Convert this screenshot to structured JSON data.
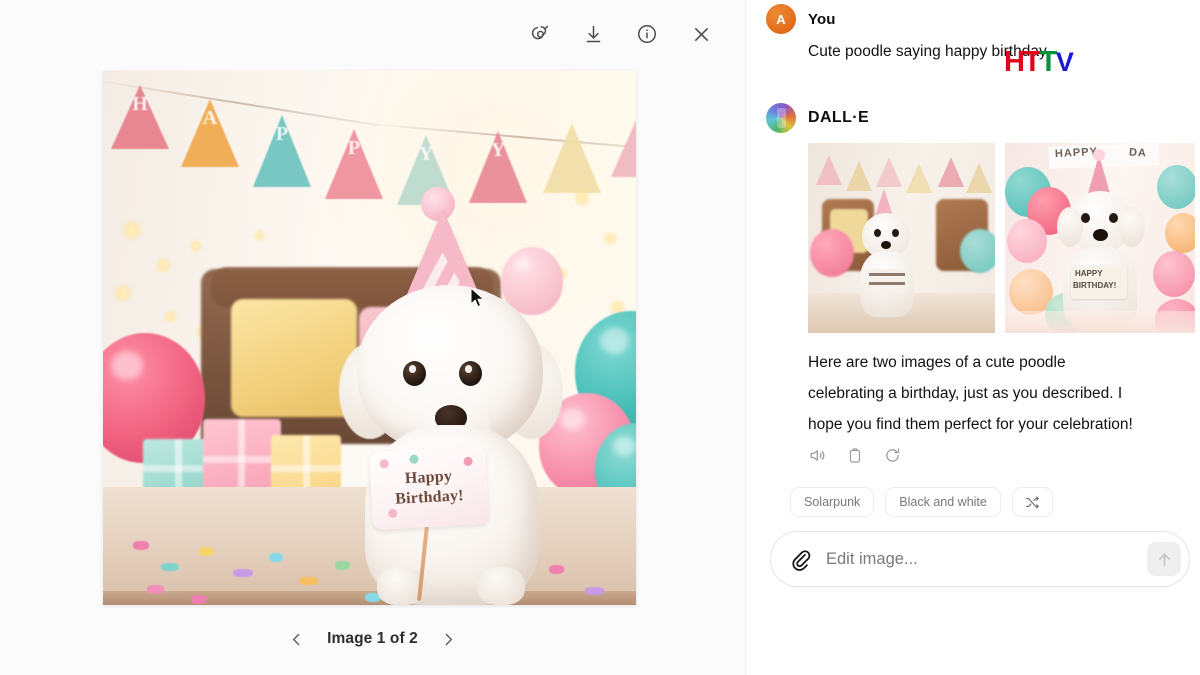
{
  "viewer": {
    "toolbar": [
      {
        "name": "select-brush-icon",
        "label": "Select"
      },
      {
        "name": "download-icon",
        "label": "Download"
      },
      {
        "name": "info-icon",
        "label": "Info"
      },
      {
        "name": "close-icon",
        "label": "Close"
      }
    ],
    "pager": {
      "label": "Image 1 of 2",
      "prev": "‹",
      "next": "›"
    },
    "image": {
      "alt": "Cute white poodle wearing a pink party hat holding a Happy Birthday sign",
      "sign_line1": "Happy",
      "sign_line2": "Birthday!",
      "banner_letters": [
        "H",
        "A",
        "P",
        "P",
        "Y",
        "Y"
      ],
      "banner_colors": [
        "#e8808c",
        "#f0a94e",
        "#6fc4c0",
        "#ef8f9c",
        "#bcd9cf",
        "#e88b97"
      ]
    }
  },
  "chat": {
    "user": {
      "avatar_letter": "A",
      "avatar_color": "#e0710f",
      "author": "You",
      "message": "Cute poodle saying happy birthday"
    },
    "assistant": {
      "author": "DALL·E",
      "message": "Here are two images of a cute poodle celebrating a birthday, just as you described. I hope you find them perfect for your celebration!",
      "thumbnails": [
        {
          "name": "thumbnail-image-1",
          "alt": "Poodle in party hat standing on bench with banner"
        },
        {
          "name": "thumbnail-image-2",
          "alt": "Poodle in party hat holding Happy Birthday sign among balloons"
        }
      ],
      "actions": [
        {
          "name": "read-aloud-icon",
          "label": "Read aloud"
        },
        {
          "name": "copy-icon",
          "label": "Copy"
        },
        {
          "name": "regenerate-icon",
          "label": "Regenerate"
        }
      ]
    },
    "suggestions": [
      {
        "name": "chip-solarpunk",
        "label": "Solarpunk"
      },
      {
        "name": "chip-black-and-white",
        "label": "Black and white"
      },
      {
        "name": "chip-shuffle",
        "label": "⤬"
      }
    ],
    "composer": {
      "placeholder": "Edit image...",
      "value": "",
      "attach_label": "Attach file",
      "send_label": "Send"
    }
  },
  "watermark": {
    "h": "H",
    "t1": "T",
    "t2": "T",
    "v": "V"
  }
}
